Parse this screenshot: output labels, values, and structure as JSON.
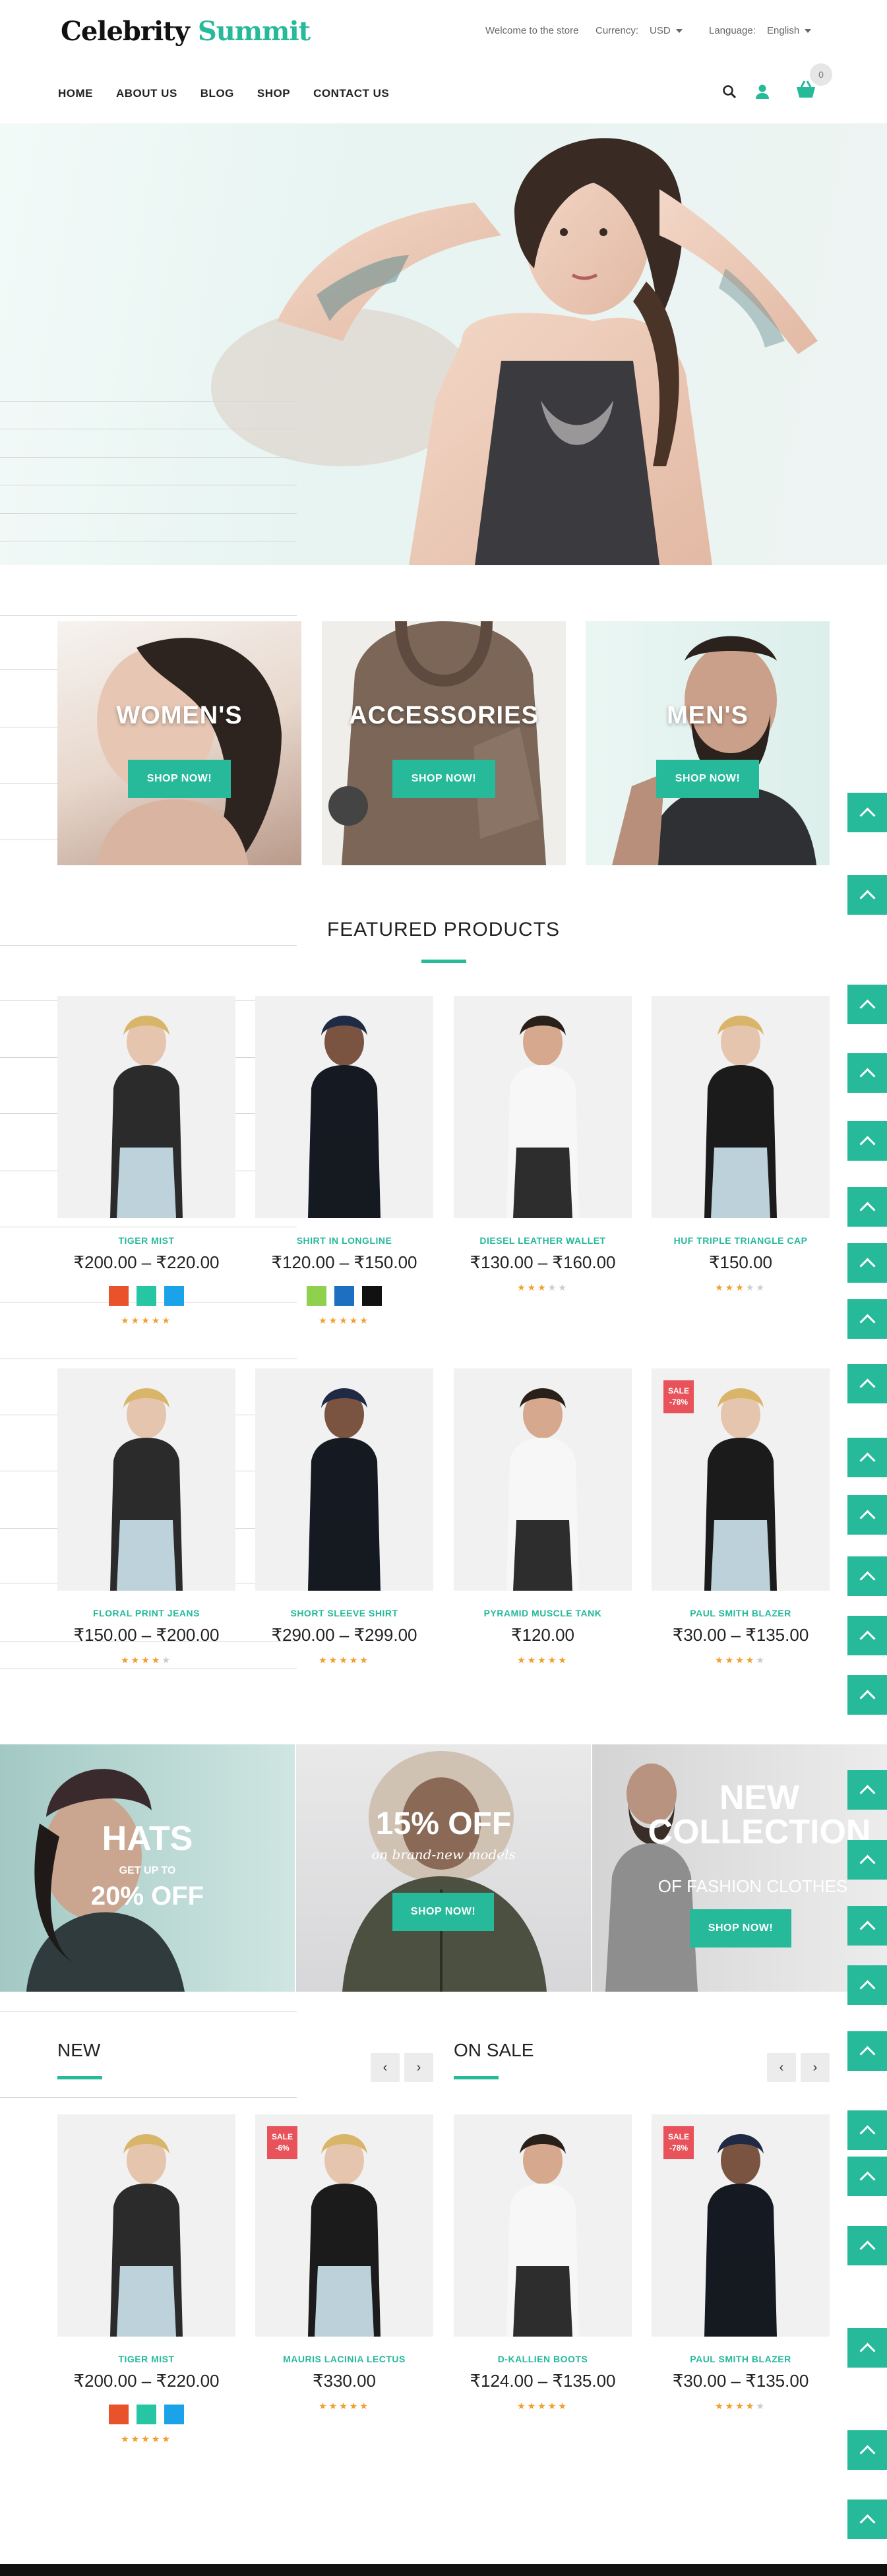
{
  "brand": {
    "name_part1": "Celebrity",
    "name_part2": "Summit"
  },
  "topbar": {
    "welcome": "Welcome to the store",
    "currency_label": "Currency:",
    "currency_value": "USD",
    "language_label": "Language:",
    "language_value": "English"
  },
  "nav": {
    "items": [
      "HOME",
      "ABOUT US",
      "BLOG",
      "SHOP",
      "CONTACT US"
    ]
  },
  "cart": {
    "count": "0"
  },
  "categories": [
    {
      "title": "WOMEN'S",
      "button": "SHOP NOW!"
    },
    {
      "title": "ACCESSORIES",
      "button": "SHOP NOW!"
    },
    {
      "title": "MEN'S",
      "button": "SHOP NOW!"
    }
  ],
  "featured": {
    "title": "FEATURED PRODUCTS",
    "products": [
      {
        "name": "TIGER MIST",
        "price": "₹200.00 – ₹220.00",
        "swatches": [
          "#e8532b",
          "#26c6a4",
          "#1aa3e8"
        ],
        "rating": 4.5
      },
      {
        "name": "SHIRT IN LONGLINE",
        "price": "₹120.00 – ₹150.00",
        "swatches": [
          "#8fd14f",
          "#1c6fc1",
          "#111111"
        ],
        "rating": 5
      },
      {
        "name": "DIESEL LEATHER WALLET",
        "price": "₹130.00 – ₹160.00",
        "swatches": [],
        "rating": 3
      },
      {
        "name": "HUF TRIPLE TRIANGLE CAP",
        "price": "₹150.00",
        "swatches": [],
        "rating": 3
      },
      {
        "name": "FLORAL PRINT JEANS",
        "price": "₹150.00 – ₹200.00",
        "swatches": [],
        "rating": 4
      },
      {
        "name": "SHORT SLEEVE SHIRT",
        "price": "₹290.00 – ₹299.00",
        "swatches": [],
        "rating": 5
      },
      {
        "name": "PYRAMID MUSCLE TANK",
        "price": "₹120.00",
        "swatches": [],
        "rating": 4.5
      },
      {
        "name": "PAUL SMITH BLAZER",
        "price": "₹30.00 – ₹135.00",
        "swatches": [],
        "rating": 4,
        "sale": "SALE -78%"
      }
    ]
  },
  "banners": [
    {
      "big": "HATS",
      "sub": "GET UP TO",
      "offer": "20% OFF"
    },
    {
      "big": "15% OFF",
      "sub": "on brand-new models",
      "button": "SHOP NOW!"
    },
    {
      "big": "NEW COLLECTION",
      "sub": "OF FASHION CLOTHES",
      "button": "SHOP NOW!"
    }
  ],
  "new_section": {
    "title": "NEW",
    "products": [
      {
        "name": "TIGER MIST",
        "price": "₹200.00 – ₹220.00",
        "swatches": [
          "#e8532b",
          "#26c6a4",
          "#1aa3e8"
        ],
        "rating": 4.5
      },
      {
        "name": "MAURIS LACINIA LECTUS",
        "price": "₹330.00",
        "swatches": [],
        "rating": 5,
        "sale": "SALE -6%"
      }
    ]
  },
  "onsale_section": {
    "title": "ON SALE",
    "products": [
      {
        "name": "D-KALLIEN BOOTS",
        "price": "₹124.00 – ₹135.00",
        "swatches": [],
        "rating": 5
      },
      {
        "name": "PAUL SMITH BLAZER",
        "price": "₹30.00 – ₹135.00",
        "swatches": [],
        "rating": 4,
        "sale": "SALE -78%"
      }
    ]
  },
  "colors": {
    "accent": "#26b99a",
    "sale": "#e8525a",
    "star": "#f0a030"
  }
}
